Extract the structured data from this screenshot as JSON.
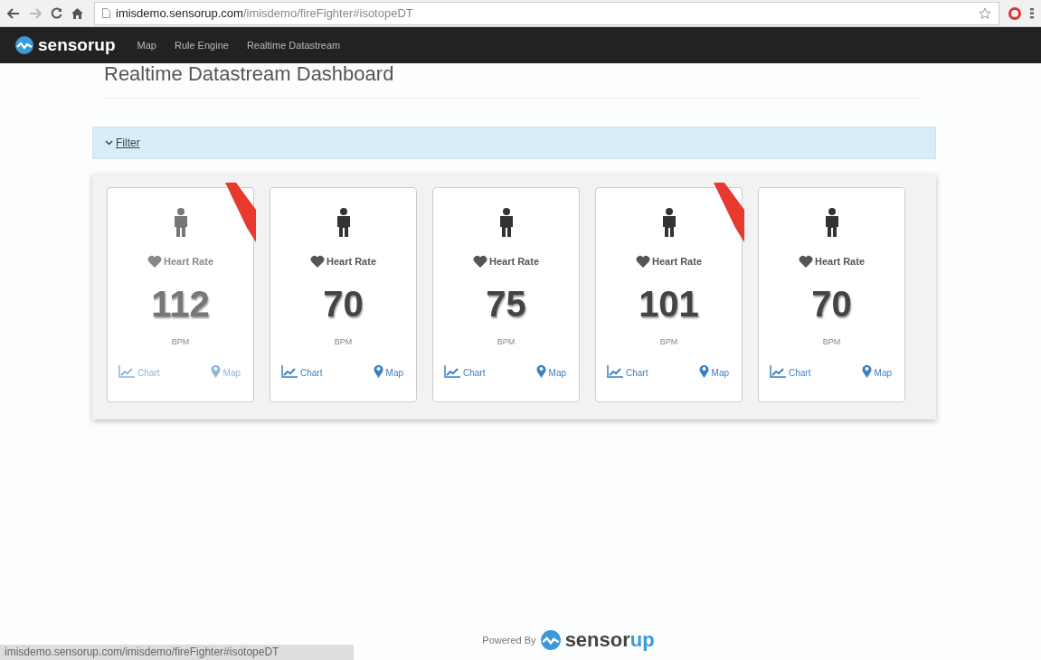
{
  "browser": {
    "url_host": "imisdemo.sensorup.com",
    "url_path": "/imisdemo/fireFighter#isotopeDT"
  },
  "navbar": {
    "brand": "sensorup",
    "links": [
      "Map",
      "Rule Engine",
      "Realtime Datastream"
    ]
  },
  "page_title": "Realtime Datastream Dashboard",
  "filter": {
    "label": "Filter",
    "expanded": true
  },
  "cards": [
    {
      "label": "Heart Rate",
      "value": "112",
      "unit": "BPM",
      "alert": true,
      "dimmed": true,
      "links": [
        "Chart",
        "Map"
      ]
    },
    {
      "label": "Heart Rate",
      "value": "70",
      "unit": "BPM",
      "alert": false,
      "dimmed": false,
      "links": [
        "Chart",
        "Map"
      ]
    },
    {
      "label": "Heart Rate",
      "value": "75",
      "unit": "BPM",
      "alert": false,
      "dimmed": false,
      "links": [
        "Chart",
        "Map"
      ]
    },
    {
      "label": "Heart Rate",
      "value": "101",
      "unit": "BPM",
      "alert": true,
      "dimmed": false,
      "links": [
        "Chart",
        "Map"
      ]
    },
    {
      "label": "Heart Rate",
      "value": "70",
      "unit": "BPM",
      "alert": false,
      "dimmed": false,
      "links": [
        "Chart",
        "Map"
      ]
    }
  ],
  "footer": {
    "powered_by": "Powered By",
    "brand_a": "sensor",
    "brand_b": "up"
  },
  "status_url": "imisdemo.sensorup.com/imisdemo/fireFighter#isotopeDT"
}
